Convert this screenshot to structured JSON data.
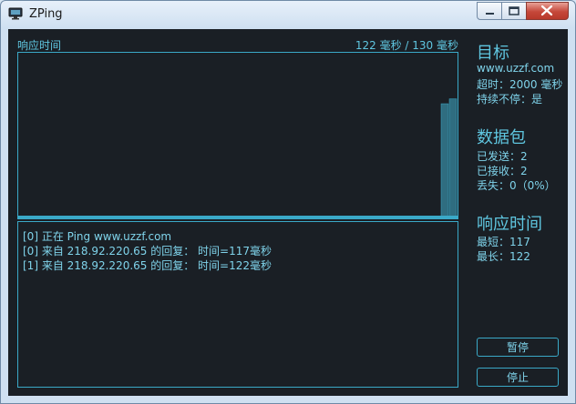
{
  "window": {
    "title": "ZPing"
  },
  "graph": {
    "label": "响应时间",
    "stats": "122 毫秒 / 130 毫秒",
    "scale_max": 130,
    "samples": [
      117,
      122
    ]
  },
  "log": {
    "lines": [
      "[0] 正在 Ping www.uzzf.com",
      "[0] 来自 218.92.220.65 的回复： 时间=117毫秒",
      "[1] 来自 218.92.220.65 的回复： 时间=122毫秒"
    ]
  },
  "target": {
    "heading": "目标",
    "host": "www.uzzf.com",
    "timeout": "超时：2000 毫秒",
    "continuous": "持续不停：是"
  },
  "packets": {
    "heading": "数据包",
    "sent": "已发送：2",
    "received": "已接收：2",
    "lost": "丢失：0（0%）"
  },
  "response": {
    "heading": "响应时间",
    "min": "最短：117",
    "max": "最长：122"
  },
  "buttons": {
    "pause": "暂停",
    "stop": "停止"
  },
  "colors": {
    "accent": "#3aa9c8",
    "background": "#1a1f25",
    "text": "#7fd3ea"
  }
}
